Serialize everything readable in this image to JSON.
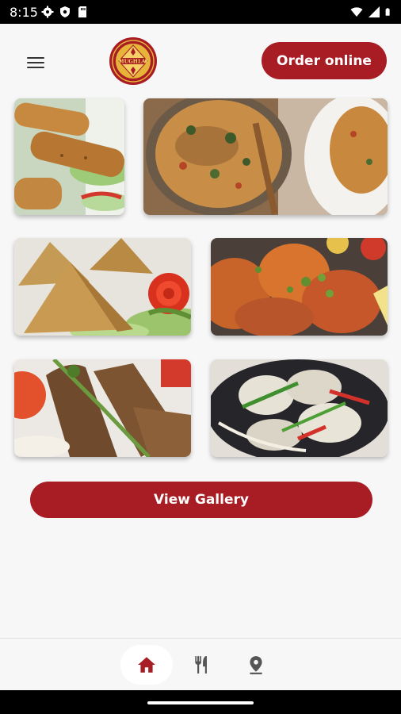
{
  "status_bar": {
    "time": "8:15",
    "left_icons": [
      "gear-icon",
      "shield-icon",
      "sd-card-icon"
    ],
    "right_icons": [
      "wifi-icon",
      "cellular-icon",
      "battery-icon"
    ]
  },
  "header": {
    "menu_icon": "hamburger-menu-icon",
    "logo_text": "MUGHLAI",
    "order_button": "Order online"
  },
  "photos": [
    {
      "name": "photo-seekh-kebab",
      "dish": "seekh kebab"
    },
    {
      "name": "photo-biryani",
      "dish": "biryani"
    },
    {
      "name": "photo-samosa",
      "dish": "samosa"
    },
    {
      "name": "photo-tandoori-chicken",
      "dish": "tandoori chicken"
    },
    {
      "name": "photo-lamb-chops",
      "dish": "lamb chops"
    },
    {
      "name": "photo-chicken-tikka",
      "dish": "chicken tikka"
    }
  ],
  "gallery_button": "View Gallery",
  "bottom_nav": {
    "items": [
      {
        "icon": "home-icon",
        "active": true
      },
      {
        "icon": "fork-knife-icon",
        "active": false
      },
      {
        "icon": "location-pin-icon",
        "active": false
      }
    ]
  },
  "colors": {
    "brand_red": "#a81c24",
    "background": "#f7f7f8",
    "logo_gold": "#e7b43a"
  }
}
